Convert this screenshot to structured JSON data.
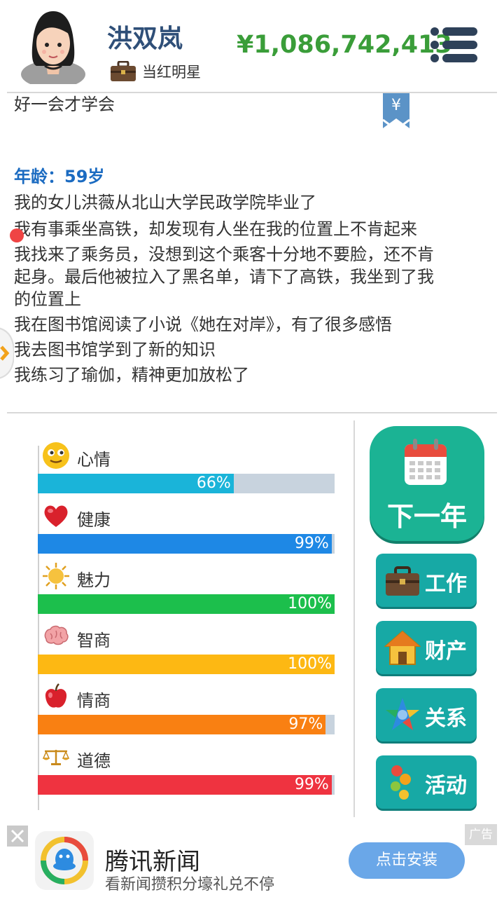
{
  "header": {
    "name": "洪双岚",
    "job": "当红明星",
    "money": "¥1,086,742,413",
    "menu_icon": "menu-icon",
    "avatar_icon": "avatar"
  },
  "log": {
    "bookmark_symbol": "¥",
    "lines": [
      "好一会才学会",
      "年龄：59岁",
      "我的女儿洪薇从北山大学民政学院毕业了",
      "我有事乘坐高铁，却发现有人坐在我的位置上不肯起来",
      "我找来了乘务员，没想到这个乘客十分地不要脸，还不肯",
      "起身。最后他被拉入了黑名单，请下了高铁，我坐到了我",
      "的位置上",
      "我在图书馆阅读了小说《她在对岸》，有了很多感悟",
      "我去图书馆学到了新的知识",
      "我练习了瑜伽，精神更加放松了"
    ]
  },
  "stats": [
    {
      "label": "心情",
      "value": 66,
      "text": "66%",
      "color": "#1ab4d9",
      "icon": "smiley-icon"
    },
    {
      "label": "健康",
      "value": 99,
      "text": "99%",
      "color": "#1e88e5",
      "icon": "heart-icon"
    },
    {
      "label": "魅力",
      "value": 100,
      "text": "100%",
      "color": "#1cbf4c",
      "icon": "sun-icon"
    },
    {
      "label": "智商",
      "value": 100,
      "text": "100%",
      "color": "#fdb813",
      "icon": "brain-icon"
    },
    {
      "label": "情商",
      "value": 97,
      "text": "97%",
      "color": "#f98012",
      "icon": "apple-icon"
    },
    {
      "label": "道德",
      "value": 99,
      "text": "99%",
      "color": "#ef3340",
      "icon": "scales-icon"
    }
  ],
  "buttons": {
    "next_year": "下一年",
    "work": "工作",
    "property": "财产",
    "relations": "关系",
    "activities": "活动"
  },
  "ad": {
    "tag": "广告",
    "title": "腾讯新闻",
    "subtitle": "看新闻攒积分壕礼兑不停",
    "install": "点击安装",
    "close_symbol": "×"
  }
}
